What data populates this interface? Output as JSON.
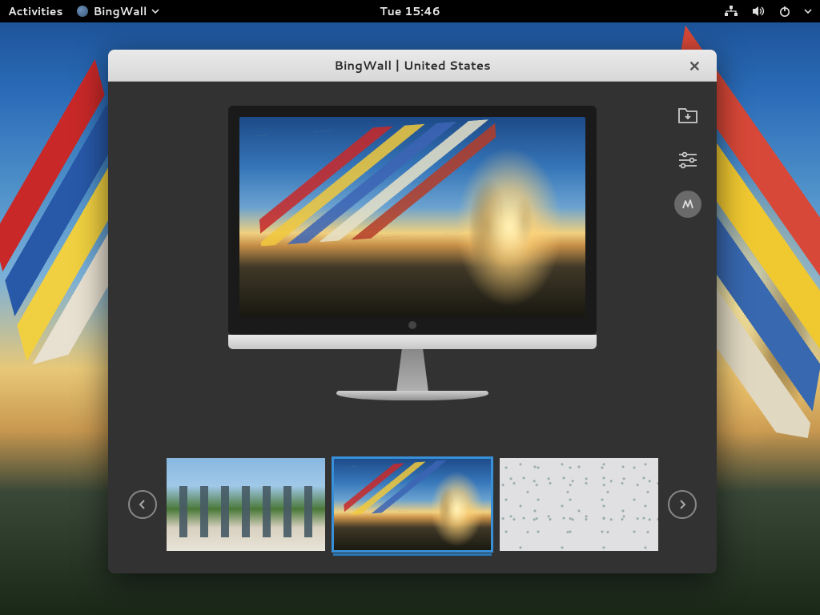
{
  "topbar": {
    "activities_label": "Activities",
    "app_name": "BingWall",
    "clock": "Tue 15:46"
  },
  "window": {
    "title": "BingWall | United States"
  },
  "tools": {
    "download": "download-to-folder",
    "settings": "settings-sliders",
    "set_wallpaper": "set-wallpaper"
  },
  "carousel": {
    "selected_index": 1,
    "thumbnails": [
      {
        "id": "thumb-band-statue"
      },
      {
        "id": "thumb-prayer-flags"
      },
      {
        "id": "thumb-snow-field"
      }
    ]
  }
}
